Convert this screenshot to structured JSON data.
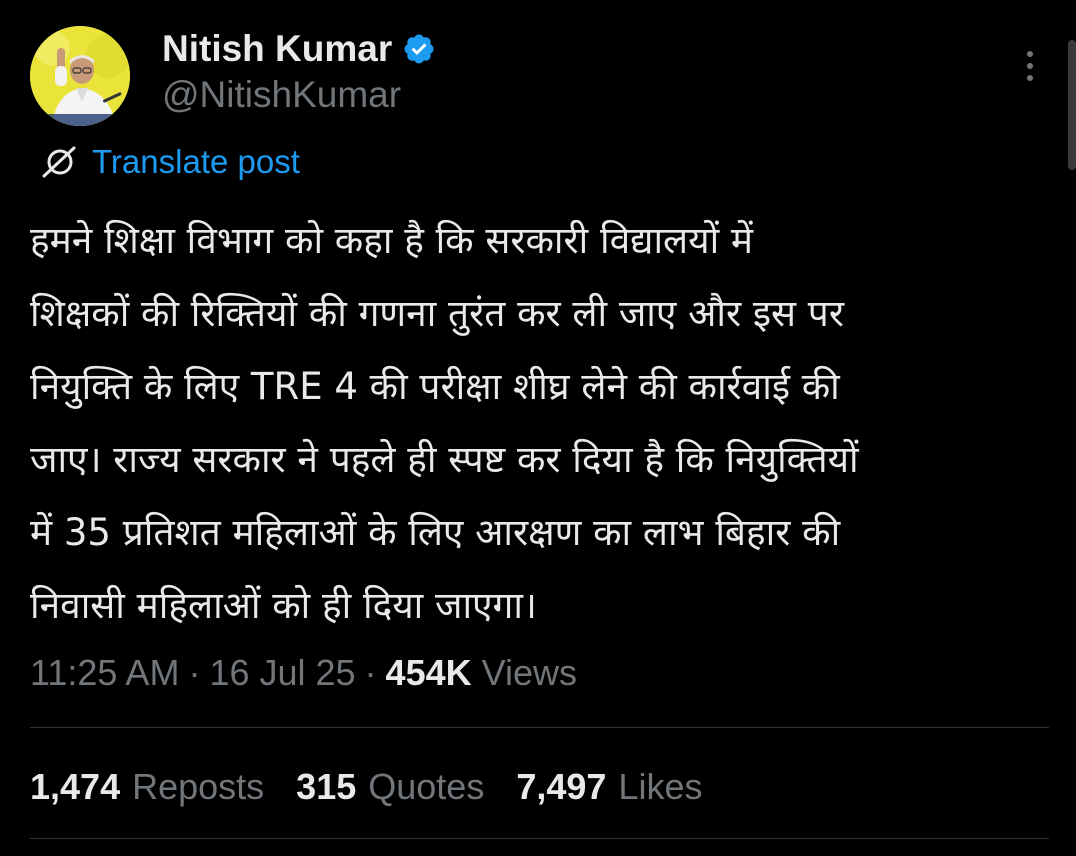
{
  "author": {
    "display_name": "Nitish Kumar",
    "handle": "@NitishKumar",
    "verified": true,
    "verified_color": "#1d9bf0",
    "avatar_background": "#e8e63a"
  },
  "icons": {
    "verified": "verified-badge-icon",
    "translate": "translate-globe-icon",
    "more": "more-vertical-icon"
  },
  "translate": {
    "label": "Translate post",
    "color": "#1d9bf0"
  },
  "tweet": {
    "lines": [
      "हमने शिक्षा विभाग को कहा है कि सरकारी विद्यालयों में",
      "शिक्षकों की रिक्तियों की गणना तुरंत कर ली जाए और इस पर",
      "नियुक्ति के लिए TRE 4 की परीक्षा शीघ्र लेने की कार्रवाई की",
      "जाए। राज्य सरकार ने पहले ही स्पष्ट कर दिया है कि नियुक्तियों",
      "में 35 प्रतिशत महिलाओं के लिए आरक्षण का लाभ बिहार की",
      "निवासी महिलाओं को ही दिया जाएगा।"
    ]
  },
  "meta": {
    "time": "11:25 AM",
    "separator": "·",
    "date": "16 Jul 25",
    "views_count": "454K",
    "views_label": "Views"
  },
  "stats": {
    "reposts_count": "1,474",
    "reposts_label": "Reposts",
    "quotes_count": "315",
    "quotes_label": "Quotes",
    "likes_count": "7,497",
    "likes_label": "Likes"
  },
  "colors": {
    "background": "#000000",
    "text_primary": "#e7e9ea",
    "text_secondary": "#71767b",
    "divider": "#2f3336",
    "link": "#1d9bf0"
  }
}
